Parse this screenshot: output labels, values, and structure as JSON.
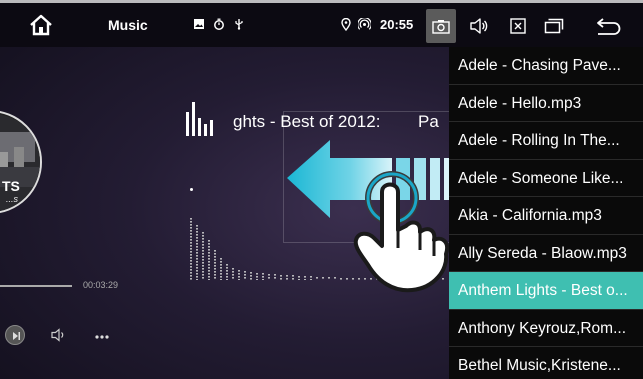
{
  "status_bar": {
    "app_title": "Music",
    "clock": "20:55"
  },
  "album": {
    "cover_text": "TS",
    "cover_subtext": "...s"
  },
  "now_playing": {
    "title_visible": "ghts - Best of 2012:",
    "title_tail": "Pa",
    "elapsed_time": "00:03:29"
  },
  "playlist": {
    "items": [
      "Adele - Chasing Pave...",
      "Adele - Hello.mp3",
      "Adele - Rolling In The...",
      "Adele - Someone Like...",
      "Akia - California.mp3",
      "Ally Sereda - Blaow.mp3",
      "Anthem Lights - Best o...",
      "Anthony Keyrouz,Rom...",
      "Bethel Music,Kristene..."
    ],
    "active_index": 6
  },
  "icons": {
    "home": "home-icon",
    "camera": "camera-icon",
    "volume": "volume-icon",
    "close": "close-box-icon",
    "windows": "windows-icon",
    "back": "back-icon"
  },
  "colors": {
    "accent": "#3fbfb1",
    "status_bar": "#0c0a12",
    "playlist_bg": "#0a0a0a"
  }
}
